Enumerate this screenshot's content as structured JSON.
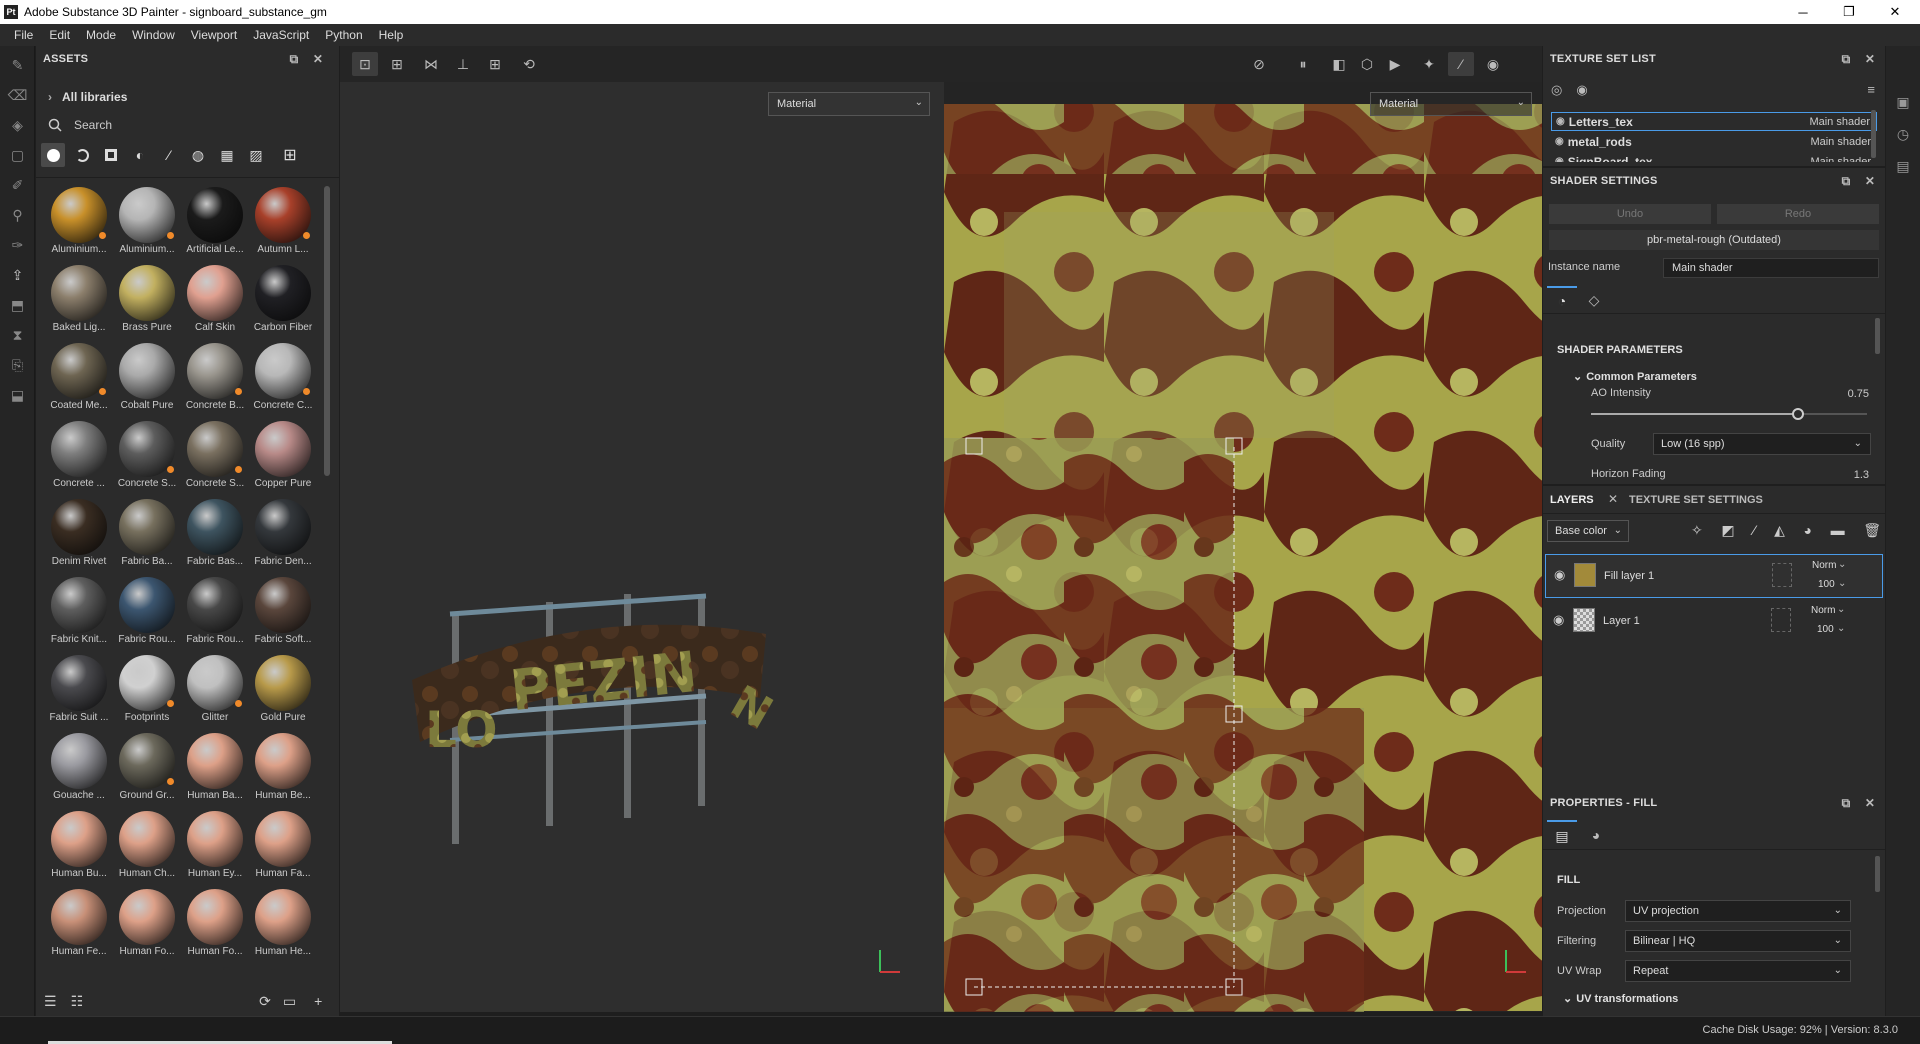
{
  "window": {
    "app_icon": "Pt",
    "title": "Adobe Substance 3D Painter - signboard_substance_gm",
    "minimize": "─",
    "maximize": "❐",
    "close": "✕"
  },
  "menu": [
    "File",
    "Edit",
    "Mode",
    "Window",
    "Viewport",
    "JavaScript",
    "Python",
    "Help"
  ],
  "assets": {
    "title": "ASSETS",
    "breadcrumb": "All libraries",
    "search_placeholder": "Search",
    "materials": [
      {
        "label": "Aluminium...",
        "color": "#c8902a",
        "badge": true
      },
      {
        "label": "Aluminium...",
        "color": "#b5b5b5",
        "badge": true
      },
      {
        "label": "Artificial Le...",
        "color": "#1b1b1b",
        "badge": false
      },
      {
        "label": "Autumn L...",
        "color": "#a8402a",
        "badge": true
      },
      {
        "label": "Baked Lig...",
        "color": "#8c7f6c",
        "badge": false
      },
      {
        "label": "Brass Pure",
        "color": "#c2b060",
        "badge": false
      },
      {
        "label": "Calf Skin",
        "color": "#e0a090",
        "badge": false
      },
      {
        "label": "Carbon Fiber",
        "color": "#202024",
        "badge": false
      },
      {
        "label": "Coated Me...",
        "color": "#6e6552",
        "badge": true
      },
      {
        "label": "Cobalt Pure",
        "color": "#aaaaaa",
        "badge": false
      },
      {
        "label": "Concrete B...",
        "color": "#9a968e",
        "badge": true
      },
      {
        "label": "Concrete C...",
        "color": "#b8b8b8",
        "badge": true
      },
      {
        "label": "Concrete ...",
        "color": "#7e7e7e",
        "badge": false
      },
      {
        "label": "Concrete S...",
        "color": "#5d5d5d",
        "badge": true
      },
      {
        "label": "Concrete S...",
        "color": "#7a7060",
        "badge": true
      },
      {
        "label": "Copper Pure",
        "color": "#b88a88",
        "badge": false
      },
      {
        "label": "Denim Rivet",
        "color": "#3a2d22",
        "badge": false
      },
      {
        "label": "Fabric Ba...",
        "color": "#77705e",
        "badge": false
      },
      {
        "label": "Fabric Bas...",
        "color": "#3e5460",
        "badge": false
      },
      {
        "label": "Fabric Den...",
        "color": "#34383c",
        "badge": false
      },
      {
        "label": "Fabric Knit...",
        "color": "#5e5e5e",
        "badge": false
      },
      {
        "label": "Fabric Rou...",
        "color": "#3c5670",
        "badge": false
      },
      {
        "label": "Fabric Rou...",
        "color": "#484848",
        "badge": false
      },
      {
        "label": "Fabric Soft...",
        "color": "#5a463c",
        "badge": false
      },
      {
        "label": "Fabric Suit ...",
        "color": "#4a4a4e",
        "badge": false
      },
      {
        "label": "Footprints",
        "color": "#d0d0d0",
        "badge": true
      },
      {
        "label": "Glitter",
        "color": "#c0c0c0",
        "badge": true
      },
      {
        "label": "Gold Pure",
        "color": "#b89a4a",
        "badge": false
      },
      {
        "label": "Gouache ...",
        "color": "#9a9aa0",
        "badge": false
      },
      {
        "label": "Ground Gr...",
        "color": "#6c695c",
        "badge": true
      },
      {
        "label": "Human Ba...",
        "color": "#dda088",
        "badge": false
      },
      {
        "label": "Human Be...",
        "color": "#dda088",
        "badge": false
      },
      {
        "label": "Human Bu...",
        "color": "#dda088",
        "badge": false
      },
      {
        "label": "Human Ch...",
        "color": "#dda088",
        "badge": false
      },
      {
        "label": "Human Ey...",
        "color": "#dda088",
        "badge": false
      },
      {
        "label": "Human Fa...",
        "color": "#dda088",
        "badge": false
      },
      {
        "label": "Human Fe...",
        "color": "#c89078",
        "badge": false
      },
      {
        "label": "Human Fo...",
        "color": "#dda088",
        "badge": false
      },
      {
        "label": "Human Fo...",
        "color": "#dda088",
        "badge": false
      },
      {
        "label": "Human He...",
        "color": "#dda088",
        "badge": false
      }
    ]
  },
  "viewport": {
    "left_mode": "Material",
    "right_mode": "Material",
    "sign_text": "LO PEZIN N"
  },
  "texture_set_list": {
    "title": "TEXTURE SET LIST",
    "rows": [
      {
        "name": "Letters_tex",
        "shader": "Main shader",
        "selected": true
      },
      {
        "name": "metal_rods",
        "shader": "Main shader",
        "selected": false
      },
      {
        "name": "SignBoard_tex",
        "shader": "Main shader",
        "selected": false
      }
    ]
  },
  "shader_settings": {
    "title": "SHADER SETTINGS",
    "undo": "Undo",
    "redo": "Redo",
    "shader_button": "pbr-metal-rough (Outdated)",
    "instance_label": "Instance name",
    "instance_value": "Main shader",
    "params_title": "SHADER PARAMETERS",
    "common_title": "Common Parameters",
    "ao_label": "AO Intensity",
    "ao_value": "0.75",
    "ao_level": 0.75,
    "quality_label": "Quality",
    "quality_value": "Low (16 spp)",
    "horizon_label": "Horizon Fading",
    "horizon_value": "1.3"
  },
  "layers": {
    "tab_layers": "LAYERS",
    "tab_texture_set": "TEXTURE SET SETTINGS",
    "channel": "Base color",
    "items": [
      {
        "name": "Fill layer 1",
        "blend": "Norm",
        "opacity": "100"
      },
      {
        "name": "Layer 1",
        "blend": "Norm",
        "opacity": "100"
      }
    ]
  },
  "properties": {
    "title": "PROPERTIES - FILL",
    "section": "FILL",
    "projection_label": "Projection",
    "projection_value": "UV projection",
    "filtering_label": "Filtering",
    "filtering_value": "Bilinear | HQ",
    "uvwrap_label": "UV Wrap",
    "uvwrap_value": "Repeat",
    "uvtrans_label": "UV transformations"
  },
  "status": {
    "cache": "Cache Disk Usage:   92% | Version: 8.3.0"
  },
  "colors": {
    "accent": "#4a9be8",
    "panel": "#2b2b2b",
    "rust": "#6b2a18",
    "moss": "#a7a54a"
  }
}
